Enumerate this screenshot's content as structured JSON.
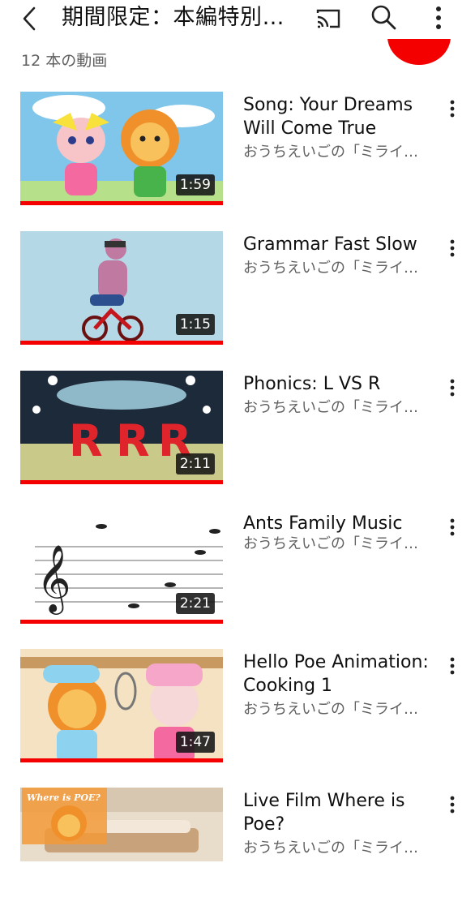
{
  "header": {
    "title": "期間限定：本編特別…",
    "back_icon": "chevron-left-icon",
    "cast_icon": "cast-icon",
    "search_icon": "search-icon",
    "more_icon": "more-vert-icon"
  },
  "video_count": "12 本の動画",
  "accent_color": "#f50000",
  "videos": [
    {
      "title": "Song: Your Dreams Will Come True",
      "channel": "おうちえいごの「ミライ…",
      "duration": "1:59",
      "watched": 1.0
    },
    {
      "title": "Grammar Fast Slow",
      "channel": "おうちえいごの「ミライ…",
      "duration": "1:15",
      "watched": 1.0
    },
    {
      "title": "Phonics: L VS R",
      "channel": "おうちえいごの「ミライ…",
      "duration": "2:11",
      "watched": 1.0
    },
    {
      "title": "Ants Family Music",
      "channel": "おうちえいごの「ミライ…",
      "duration": "2:21",
      "watched": 1.0
    },
    {
      "title": "Hello Poe Animation: Cooking 1",
      "channel": "おうちえいごの「ミライ…",
      "duration": "1:47",
      "watched": 1.0
    },
    {
      "title": "Live Film Where is Poe?",
      "channel": "おうちえいごの「ミライ…",
      "duration": "",
      "watched": 0.0,
      "thumb_text": "Where is POE?"
    }
  ]
}
